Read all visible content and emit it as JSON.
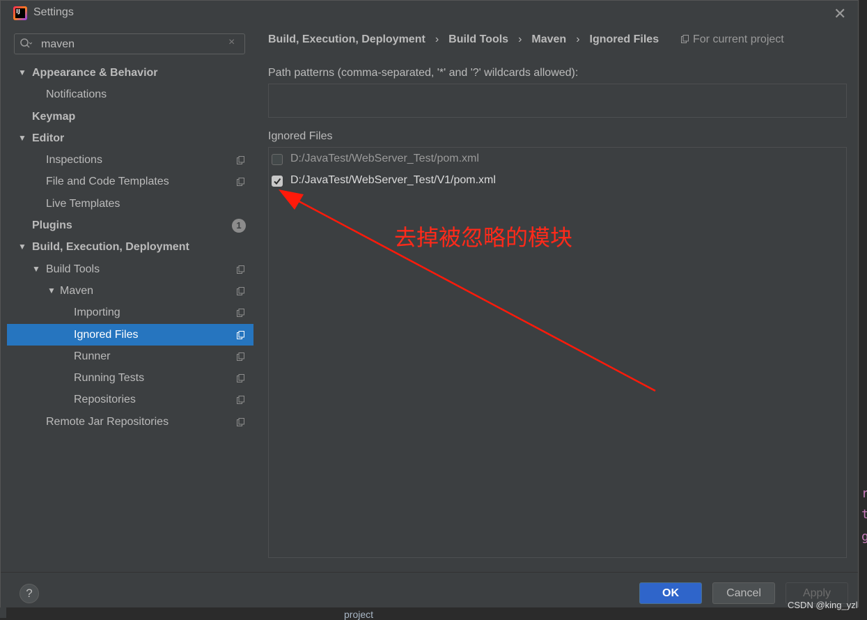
{
  "window": {
    "title": "Settings",
    "logo_text": "IJ"
  },
  "search": {
    "value": "maven",
    "clear_glyph": "×"
  },
  "tree": [
    {
      "label": "Appearance & Behavior",
      "bold": true,
      "arrow": "▼",
      "level": 0,
      "project": false
    },
    {
      "label": "Notifications",
      "bold": false,
      "arrow": "",
      "level": 1,
      "project": false
    },
    {
      "label": "Keymap",
      "bold": true,
      "arrow": "",
      "level": 0,
      "project": false
    },
    {
      "label": "Editor",
      "bold": true,
      "arrow": "▼",
      "level": 0,
      "project": false
    },
    {
      "label": "Inspections",
      "bold": false,
      "arrow": "",
      "level": 1,
      "project": true
    },
    {
      "label": "File and Code Templates",
      "bold": false,
      "arrow": "",
      "level": 1,
      "project": true
    },
    {
      "label": "Live Templates",
      "bold": false,
      "arrow": "",
      "level": 1,
      "project": false
    },
    {
      "label": "Plugins",
      "bold": true,
      "arrow": "",
      "level": 0,
      "project": false,
      "badge": "1"
    },
    {
      "label": "Build, Execution, Deployment",
      "bold": true,
      "arrow": "▼",
      "level": 0,
      "project": false
    },
    {
      "label": "Build Tools",
      "bold": false,
      "arrow": "▼",
      "level": 1,
      "project": true
    },
    {
      "label": "Maven",
      "bold": false,
      "arrow": "▼",
      "level": 2,
      "project": true
    },
    {
      "label": "Importing",
      "bold": false,
      "arrow": "",
      "level": 3,
      "project": true
    },
    {
      "label": "Ignored Files",
      "bold": false,
      "arrow": "",
      "level": 3,
      "project": true,
      "selected": true
    },
    {
      "label": "Runner",
      "bold": false,
      "arrow": "",
      "level": 3,
      "project": true
    },
    {
      "label": "Running Tests",
      "bold": false,
      "arrow": "",
      "level": 3,
      "project": true
    },
    {
      "label": "Repositories",
      "bold": false,
      "arrow": "",
      "level": 3,
      "project": true
    },
    {
      "label": "Remote Jar Repositories",
      "bold": false,
      "arrow": "",
      "level": 1,
      "project": true
    }
  ],
  "breadcrumb": {
    "items": [
      "Build, Execution, Deployment",
      "Build Tools",
      "Maven",
      "Ignored Files"
    ],
    "separator": "›"
  },
  "for_project": "For current project",
  "path_patterns": {
    "label": "Path patterns (comma-separated, '*' and '?' wildcards allowed):",
    "value": ""
  },
  "ignored_files": {
    "label": "Ignored Files",
    "rows": [
      {
        "path": "D:/JavaTest/WebServer_Test/pom.xml",
        "checked": false
      },
      {
        "path": "D:/JavaTest/WebServer_Test/V1/pom.xml",
        "checked": true
      }
    ]
  },
  "annotation": {
    "text": "去掉被忽略的模块",
    "color": "#ff2a1a"
  },
  "footer": {
    "help": "?",
    "ok": "OK",
    "cancel": "Cancel",
    "apply": "Apply"
  },
  "background": {
    "code_chars": [
      "r",
      "t",
      "g"
    ],
    "bottom_text": "project"
  },
  "watermark": "CSDN @king_yzl",
  "colors": {
    "selection": "#2675bf",
    "ok_button": "#2f65ca",
    "panel": "#3c3f41"
  }
}
